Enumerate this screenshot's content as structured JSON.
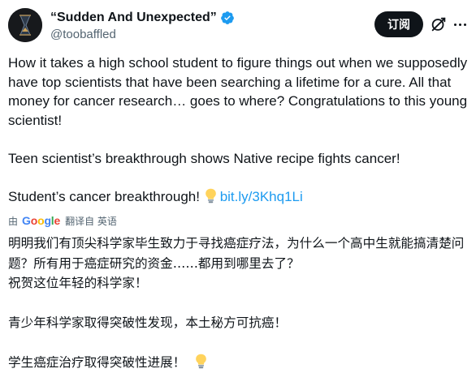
{
  "author": {
    "display_name": "“Sudden And Unexpected”",
    "handle": "@toobaffled",
    "verified": true,
    "avatar_icon": "hourglass-avatar"
  },
  "actions": {
    "subscribe_label": "订阅",
    "grok_icon": "grok-icon",
    "more_icon": "more-icon"
  },
  "tweet": {
    "paragraphs": [
      "How it takes a high school student to figure things out when we supposedly have top scientists that have been searching a lifetime for a cure.  All that money for cancer research… goes to where? Congratulations to this young scientist!",
      "Teen scientist’s breakthrough shows Native recipe fights cancer!",
      "Student’s cancer breakthrough!"
    ],
    "link_text": "bit.ly/3Khq1Li",
    "link_color": "#1d9bf0"
  },
  "translation": {
    "by_label": "由",
    "provider": "Google",
    "translated_from": "翻译自 英语",
    "paragraphs": [
      "明明我们有顶尖科学家毕生致力于寻找癌症疗法，为什么一个高中生就能搞清楚问题？所有用于癌症研究的资金……都用到哪里去了？",
      "祝贺这位年轻的科学家！",
      "青少年科学家取得突破性发现，本土秘方可抗癌！",
      "学生癌症治疗取得突破性进展！"
    ]
  },
  "colors": {
    "text": "#0f1419",
    "secondary": "#536471",
    "accent": "#1d9bf0",
    "button_bg": "#0f1419"
  }
}
